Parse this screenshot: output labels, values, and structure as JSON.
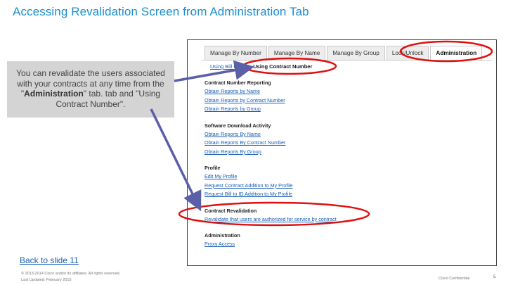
{
  "slide": {
    "title": "Accessing Revalidation Screen from Administration Tab",
    "back_link": "Back to slide 11",
    "footer_copyright": "© 2013-2014 Cisco and/or its affiliates. All rights reserved.",
    "footer_updated": "Last Updated: February 2015",
    "footer_confidential": "Cisco Confidential",
    "page_number": "5"
  },
  "callout": {
    "text_before": "You can revalidate the users associated with your contracts at any time from the \"",
    "bold": "Administration",
    "text_after": "\" tab. tab and \"Using Contract Number\"."
  },
  "screenshot": {
    "tabs": [
      {
        "label": "Manage By Number",
        "active": false
      },
      {
        "label": "Manage By Name",
        "active": false
      },
      {
        "label": "Manage By Group",
        "active": false
      },
      {
        "label": "Lock/Unlock",
        "active": false
      },
      {
        "label": "Administration",
        "active": true
      }
    ],
    "subtabs": [
      {
        "label": "Using Bill to ID",
        "active": false
      },
      {
        "label": "Using Contract Number",
        "active": true
      }
    ],
    "sections": [
      {
        "heading": "Contract Number Reporting",
        "links": [
          "Obtain Reports by Name",
          "Obtain Reports by Contract Number",
          "Obtain Reports by Group"
        ]
      },
      {
        "heading": "Software Download Activity",
        "links": [
          "Obtain Reports By Name",
          "Obtain Reports By Contract Number",
          "Obtain Reports By Group"
        ]
      },
      {
        "heading": "Profile",
        "links": [
          "Edit My Profile",
          "Request Contract Addition to My Profile",
          "Request Bill to ID Addition to My Profile"
        ]
      },
      {
        "heading": "Contract Revalidation",
        "links": [
          "Revalidate that users are authorized for service by contract"
        ]
      },
      {
        "heading": "Administration",
        "links": [
          "Proxy Access"
        ]
      }
    ]
  },
  "colors": {
    "title": "#1a8ecf",
    "callout_bg": "#d4d4d4",
    "link": "#1a5fb4",
    "highlight_ellipse": "#e01010",
    "arrow": "#5b5fa8"
  }
}
